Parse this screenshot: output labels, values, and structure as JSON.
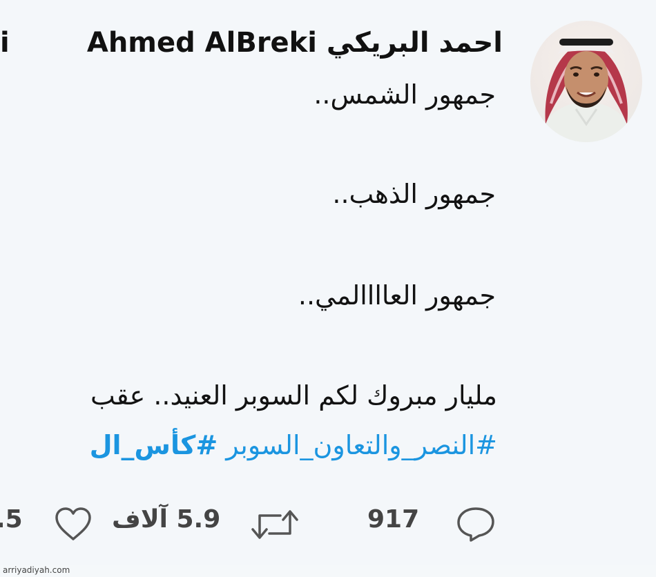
{
  "tweet": {
    "author_name": "Ahmed AlBreki احمد البريكي",
    "author_name_cut": "i",
    "lines": [
      "جمهور الشمس..",
      "جمهور الذهب..",
      "جمهور العاااالمي..",
      "مليار مبروك لكم السوبر العنيد.. عقب"
    ],
    "hashtags": {
      "first": "#النصر_والتعاون_السوبر",
      "second": "#كأس_ال"
    },
    "actions": {
      "replies": "917",
      "retweets": "5.9 آلاف",
      "likes": ".5"
    }
  },
  "watermark": "arriyadiyah.com",
  "colors": {
    "hashtag": "#1b95e0",
    "background": "#f4f7fa"
  },
  "icons": [
    "reply-icon",
    "retweet-icon",
    "like-icon"
  ]
}
